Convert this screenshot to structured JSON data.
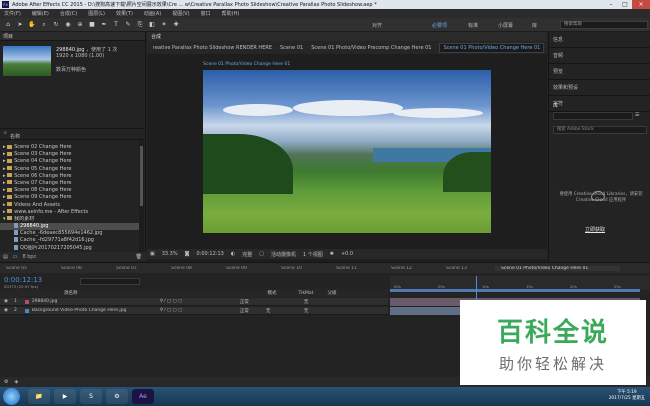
{
  "window": {
    "title": "Adobe After Effects CC 2015 - D:\\搜狗高速下载\\照片空间展示效果\\Cre ... w\\Creative Parallax Photo Slideshow\\Creative Parallax Photo Slideshow.aep *",
    "app_icon": "Ae"
  },
  "menu": [
    "文件(F)",
    "编辑(E)",
    "合成(C)",
    "图层(L)",
    "效果(T)",
    "动画(A)",
    "视图(V)",
    "窗口",
    "帮助(H)"
  ],
  "toolbar": {
    "snap_label": "对齐",
    "workspaces": [
      "必要项",
      "标准",
      "小屏幕",
      "库"
    ],
    "search_placeholder": "搜索帮助"
  },
  "project": {
    "panel_title": "项目",
    "asset_name": "298840.jpg",
    "asset_usage": "，使用了 1 次",
    "asset_dims": "1920 x 1080 (1.00)",
    "asset_depth": "数百万种颜色",
    "col_name": "名称",
    "bpc": "8 bpc",
    "items": [
      {
        "label": "Scene 02 Change Here",
        "type": "folder"
      },
      {
        "label": "Scene 03 Change Here",
        "type": "folder"
      },
      {
        "label": "Scene 04 Change Here",
        "type": "folder"
      },
      {
        "label": "Scene 05 Change Here",
        "type": "folder"
      },
      {
        "label": "Scene 06 Change Here",
        "type": "folder"
      },
      {
        "label": "Scene 07 Change Here",
        "type": "folder"
      },
      {
        "label": "Scene 08 Change Here",
        "type": "folder"
      },
      {
        "label": "Scene 09 Change Here",
        "type": "folder"
      },
      {
        "label": "Videos And Assets",
        "type": "folder"
      },
      {
        "label": "www.aeinfo.me - After Effects",
        "type": "folder"
      },
      {
        "label": "我的素材",
        "type": "folder"
      },
      {
        "label": "298840.jpg",
        "type": "file",
        "selected": true
      },
      {
        "label": "Cache_-6deaec855694e1462.jpg",
        "type": "file"
      },
      {
        "label": "Cache_-fd29771a8f42d16.jpg",
        "type": "file"
      },
      {
        "label": "QQ图片20170217205045.jpg",
        "type": "file"
      }
    ]
  },
  "composition": {
    "panel_tabs": [
      "合成"
    ],
    "crumbs": [
      "reative Parallax Photo Slideshow RENDER HERE",
      "Scene 01",
      "Scene 01 Photo/Video Precomp Change Here 01",
      "Scene 01 Photo/Video Change Here 01"
    ],
    "viewer_label": "Scene 01 Photo/Video Change Here 01",
    "zoom": "33.3%",
    "time": "0:00:12:13",
    "resolution": "完整",
    "camera": "活动摄像机",
    "views": "1 个视图",
    "offset": "+0.0"
  },
  "right_panel": {
    "items": [
      "信息",
      "音频",
      "预览",
      "效果和预设",
      "字符"
    ],
    "library_title": "库",
    "library_search": "搜索 Adobe Stock",
    "library_message": "要使用 Creative Cloud Libraries，请安装 Creative Cloud 应用程序",
    "library_link": "立即获取"
  },
  "timeline": {
    "tabs": [
      "Scene 05",
      "Scene 06",
      "Scene 07",
      "Scene 08",
      "Scene 09",
      "Scene 10",
      "Scene 11",
      "Scene 12",
      "Scene 13",
      "Scene 01 Photo/Video Change Here 01"
    ],
    "active_tab": "Scene 01 Photo/Video Change Here 01",
    "timecode": "0:00:12:13",
    "fps": "00373 (29.97 fps)",
    "columns": {
      "name": "源名称",
      "mode": "模式",
      "trkmat": "TrkMat",
      "parent": "父级"
    },
    "layers": [
      {
        "num": "1",
        "name": "298840.jpg",
        "mode": "正常",
        "parent": "无",
        "color": "#b04a7a"
      },
      {
        "num": "2",
        "name": "Background Video-Photo Change Here.jpg",
        "mode": "正常",
        "trkmat": "无",
        "parent": "无",
        "color": "#4a88c4"
      }
    ],
    "ruler": [
      "00s",
      "05s",
      "10s",
      "15s",
      "20s",
      "25s"
    ]
  },
  "taskbar": {
    "clock_time": "下午 5:19",
    "clock_date": "2017/7/25 星期五",
    "ae_label": "Ae"
  },
  "watermark": {
    "title": "百科全说",
    "subtitle": "助你轻松解决"
  }
}
